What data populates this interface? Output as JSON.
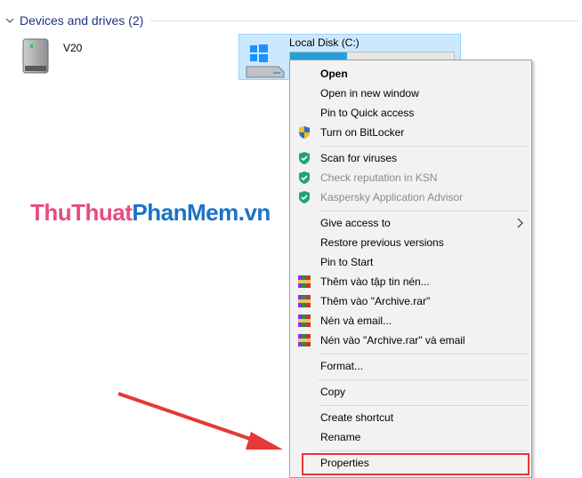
{
  "group": {
    "title": "Devices and drives (2)"
  },
  "drives": [
    {
      "name": "V20",
      "icon": "removable-drive-icon"
    },
    {
      "name": "Local Disk (C:)",
      "icon": "windows-drive-icon",
      "usage_fraction": 0.35,
      "bar_color": "#26a0da"
    }
  ],
  "watermark": {
    "part1": "ThuThuat",
    "part2": "PhanMem",
    "part3": ".vn",
    "color1": "#e84c7c",
    "color2": "#1a73c8"
  },
  "context_menu": {
    "items": [
      {
        "label": "Open",
        "bold": true
      },
      {
        "label": "Open in new window"
      },
      {
        "label": "Pin to Quick access"
      },
      {
        "label": "Turn on BitLocker",
        "icon": "uac-shield-icon"
      },
      {
        "label": "Scan for viruses",
        "icon": "kaspersky-shield-icon"
      },
      {
        "label": "Check reputation in KSN",
        "icon": "kaspersky-shield-icon",
        "disabled": true
      },
      {
        "label": "Kaspersky Application Advisor",
        "icon": "kaspersky-shield-icon",
        "disabled": true
      },
      {
        "label": "Give access to",
        "submenu": true
      },
      {
        "label": "Restore previous versions"
      },
      {
        "label": "Pin to Start"
      },
      {
        "label": "Thêm vào tập tin nén...",
        "icon": "winrar-icon"
      },
      {
        "label": "Thêm vào \"Archive.rar\"",
        "icon": "winrar-icon"
      },
      {
        "label": "Nén và email...",
        "icon": "winrar-icon"
      },
      {
        "label": "Nén vào \"Archive.rar\" và email",
        "icon": "winrar-icon"
      },
      {
        "label": "Format..."
      },
      {
        "label": "Copy"
      },
      {
        "label": "Create shortcut"
      },
      {
        "label": "Rename"
      },
      {
        "label": "Properties"
      }
    ]
  },
  "annotation": {
    "highlighted_item": "Properties",
    "color": "#e53935"
  }
}
